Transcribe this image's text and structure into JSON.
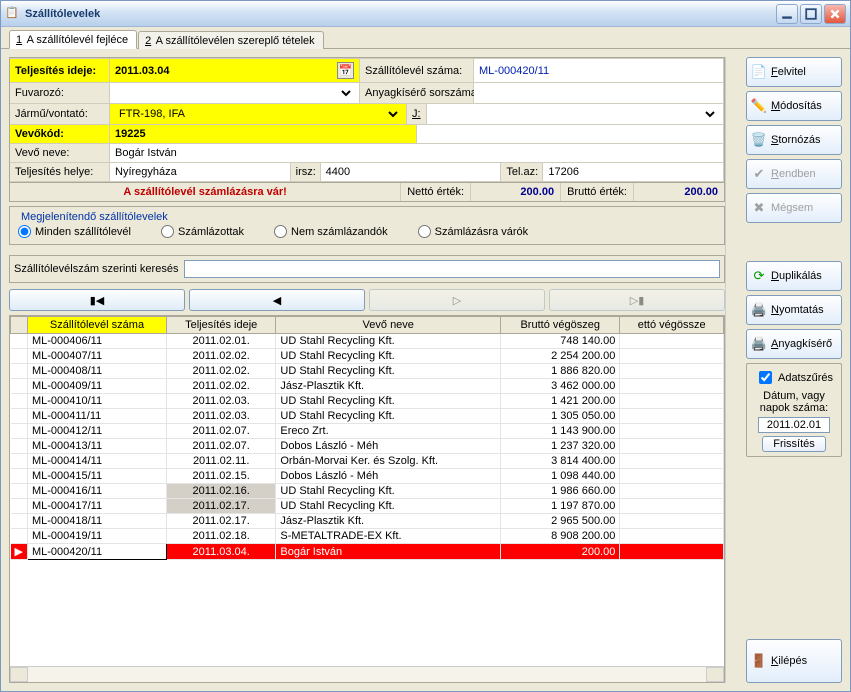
{
  "window_title": "Szállítólevelek",
  "tabs": [
    {
      "num": "1",
      "label": "A szállítólevél fejléce"
    },
    {
      "num": "2",
      "label": "A szállítólevélen szereplő tételek"
    }
  ],
  "form": {
    "teljesites_ideje_lbl": "Teljesítés ideje:",
    "teljesites_ideje_val": "2011.03.04",
    "szallitolevel_szama_lbl": "Szállítólevél száma:",
    "szallitolevel_szama_val": "ML-000420/11",
    "fuvarozo_lbl": "Fuvarozó:",
    "fuvarozo_val": "",
    "anyagkisero_lbl": "Anyagkísérő sorszáma:",
    "anyagkisero_val": "",
    "jarmu_lbl": "Jármű/vontató:",
    "jarmu_val": "FTR-198, IFA",
    "jarmu_j_lbl": "J:",
    "jarmu_j_val": "",
    "vevokod_lbl": "Vevőkód:",
    "vevokod_val": "19225",
    "vevoneve_lbl": "Vevő neve:",
    "vevoneve_val": "Bogár István",
    "telj_helye_lbl": "Teljesítés helye:",
    "telj_helye_val": "Nyíregyháza",
    "irsz_lbl": "irsz:",
    "irsz_val": "4400",
    "telaz_lbl": "Tel.az:",
    "telaz_val": "17206"
  },
  "status": {
    "msg": "A szállítólevél számlázásra vár!",
    "netto_lbl": "Nettó érték:",
    "netto_val": "200.00",
    "brutto_lbl": "Bruttó érték:",
    "brutto_val": "200.00"
  },
  "filter_group": {
    "legend": "Megjelenítendő szállítólevelek",
    "options": [
      "Minden szállítólevél",
      "Számlázottak",
      "Nem számlázandók",
      "Számlázásra várók"
    ],
    "selected": 0
  },
  "search_lbl": "Szállítólevélszám szerinti keresés",
  "grid": {
    "headers": [
      "Szállítólevél száma",
      "Teljesítés ideje",
      "Vevő neve",
      "Bruttó végöszeg",
      "ettó végössze"
    ],
    "rows": [
      {
        "id": "ML-000406/11",
        "date": "2011.02.01.",
        "name": "UD Stahl Recycling Kft.",
        "sum": "748 140.00",
        "gray": false
      },
      {
        "id": "ML-000407/11",
        "date": "2011.02.02.",
        "name": "UD Stahl Recycling Kft.",
        "sum": "2 254 200.00",
        "gray": false
      },
      {
        "id": "ML-000408/11",
        "date": "2011.02.02.",
        "name": "UD Stahl Recycling Kft.",
        "sum": "1 886 820.00",
        "gray": false
      },
      {
        "id": "ML-000409/11",
        "date": "2011.02.02.",
        "name": "Jász-Plasztik Kft.",
        "sum": "3 462 000.00",
        "gray": false
      },
      {
        "id": "ML-000410/11",
        "date": "2011.02.03.",
        "name": "UD Stahl Recycling Kft.",
        "sum": "1 421 200.00",
        "gray": false
      },
      {
        "id": "ML-000411/11",
        "date": "2011.02.03.",
        "name": "UD Stahl Recycling Kft.",
        "sum": "1 305 050.00",
        "gray": false
      },
      {
        "id": "ML-000412/11",
        "date": "2011.02.07.",
        "name": "Ereco Zrt.",
        "sum": "1 143 900.00",
        "gray": false
      },
      {
        "id": "ML-000413/11",
        "date": "2011.02.07.",
        "name": "Dobos László - Méh",
        "sum": "1 237 320.00",
        "gray": false
      },
      {
        "id": "ML-000414/11",
        "date": "2011.02.11.",
        "name": "Orbán-Morvai Ker. és Szolg. Kft.",
        "sum": "3 814 400.00",
        "gray": false
      },
      {
        "id": "ML-000415/11",
        "date": "2011.02.15.",
        "name": "Dobos László - Méh",
        "sum": "1 098 440.00",
        "gray": false
      },
      {
        "id": "ML-000416/11",
        "date": "2011.02.16.",
        "name": "UD Stahl Recycling Kft.",
        "sum": "1 986 660.00",
        "gray": true
      },
      {
        "id": "ML-000417/11",
        "date": "2011.02.17.",
        "name": "UD Stahl Recycling Kft.",
        "sum": "1 197 870.00",
        "gray": true
      },
      {
        "id": "ML-000418/11",
        "date": "2011.02.17.",
        "name": "Jász-Plasztik Kft.",
        "sum": "2 965 500.00",
        "gray": false
      },
      {
        "id": "ML-000419/11",
        "date": "2011.02.18.",
        "name": "S-METALTRADE-EX Kft.",
        "sum": "8 908 200.00",
        "gray": false
      },
      {
        "id": "ML-000420/11",
        "date": "2011.03.04.",
        "name": "Bogár István",
        "sum": "200.00",
        "gray": true,
        "sel": true
      }
    ]
  },
  "sidebar": {
    "felvitel": "Felvitel",
    "modositas": "Módosítás",
    "stornozas": "Stornózás",
    "rendben": "Rendben",
    "megsem": "Mégsem",
    "duplikal": "Duplikálás",
    "nyomtatas": "Nyomtatás",
    "anyagkisero": "Anyagkísérő",
    "kilepes": "Kilépés",
    "adatszures": "Adatszűrés",
    "datum_lbl": "Dátum, vagy napok száma:",
    "datum_val": "2011.02.01",
    "frissites": "Frissítés"
  }
}
